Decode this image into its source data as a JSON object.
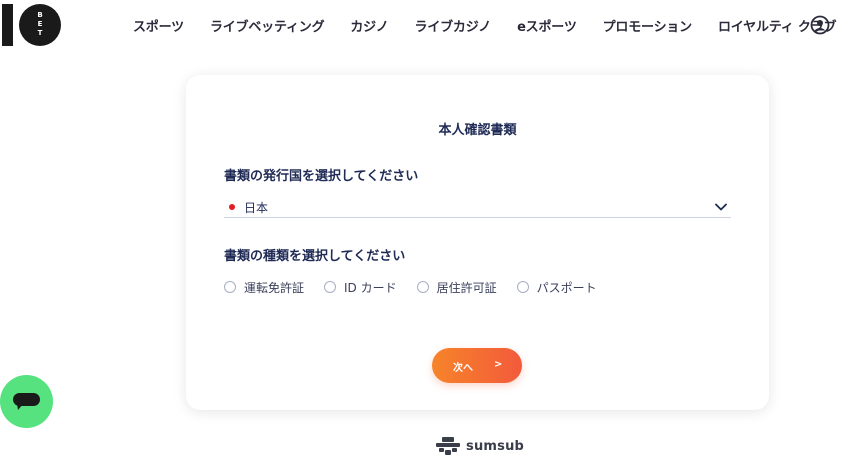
{
  "header": {
    "logo_text": "10BET",
    "nav": [
      {
        "label": "スポーツ"
      },
      {
        "label": "ライブベッティング"
      },
      {
        "label": "カジノ"
      },
      {
        "label": "ライブカジノ"
      },
      {
        "label": "eスポーツ"
      },
      {
        "label": "プロモーション"
      },
      {
        "label": "ロイヤルティ クラブ"
      }
    ],
    "account_icon": "user-circle-icon"
  },
  "card": {
    "title": "本人確認書類",
    "country_label": "書類の発行国を選択してください",
    "country_value": "日本",
    "country_flag_color": "#e31b23",
    "doc_type_label": "書類の種類を選択してください",
    "doc_types": [
      {
        "label": "運転免許証"
      },
      {
        "label": "ID カード"
      },
      {
        "label": "居住許可証"
      },
      {
        "label": "パスポート"
      }
    ],
    "next_button": {
      "label": "次へ",
      "arrow": ">"
    }
  },
  "footer": {
    "brand": "sumsub"
  },
  "chat_widget": {
    "icon": "chat-bubble-icon",
    "color": "#55e27f"
  },
  "colors": {
    "accent_start": "#f7842a",
    "accent_end": "#f25a3b",
    "heading": "#1f2a55"
  }
}
